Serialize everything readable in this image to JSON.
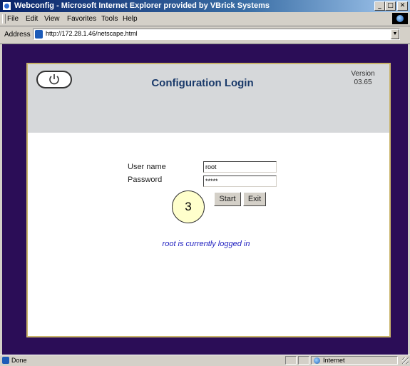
{
  "window": {
    "title": "Webconfig - Microsoft Internet Explorer provided by VBrick Systems",
    "minimize_glyph": "_",
    "maximize_glyph": "□",
    "close_glyph": "✕"
  },
  "menu": {
    "items": [
      "File",
      "Edit",
      "View",
      "Favorites",
      "Tools",
      "Help"
    ]
  },
  "address": {
    "label": "Address",
    "url": "http://172.28.1.46/netscape.html",
    "dropdown_glyph": "▼"
  },
  "page": {
    "title": "Configuration Login",
    "version_label": "Version",
    "version_number": "03.65",
    "power_icon": "power-icon",
    "username_label": "User name",
    "username_value": "root",
    "password_label": "Password",
    "password_value": "*****",
    "start_button": "Start",
    "exit_button": "Exit",
    "callout_number": "3",
    "status_message": "root is currently logged in"
  },
  "statusbar": {
    "text": "Done",
    "zone": "Internet"
  },
  "colors": {
    "background_purple": "#2b0d57",
    "header_gray": "#d6d8da",
    "title_blue": "#1a3a6a",
    "message_blue": "#2020c0",
    "panel_border_gold": "#c9b46a",
    "callout_yellow": "#ffffcc"
  }
}
